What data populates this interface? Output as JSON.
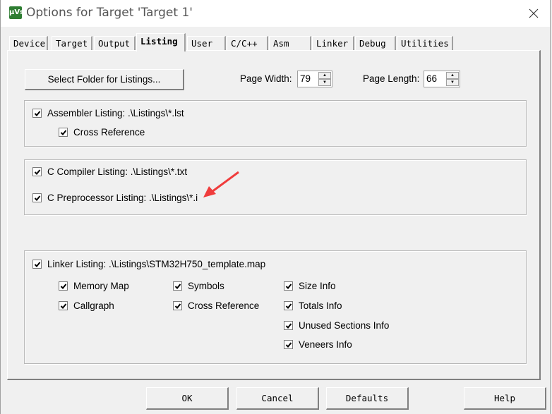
{
  "window": {
    "title": "Options for Target 'Target 1'",
    "app_icon_label": "µVs"
  },
  "tabs": [
    {
      "label": "Device",
      "active": false
    },
    {
      "label": "Target",
      "active": false
    },
    {
      "label": "Output",
      "active": false
    },
    {
      "label": "Listing",
      "active": true
    },
    {
      "label": "User",
      "active": false
    },
    {
      "label": "C/C++",
      "active": false
    },
    {
      "label": "Asm",
      "active": false
    },
    {
      "label": "Linker",
      "active": false
    },
    {
      "label": "Debug",
      "active": false
    },
    {
      "label": "Utilities",
      "active": false
    }
  ],
  "listing": {
    "select_folder_button": "Select Folder for Listings...",
    "page_width_label": "Page Width:",
    "page_width_value": "79",
    "page_length_label": "Page Length:",
    "page_length_value": "66",
    "assembler": {
      "label": "Assembler Listing:  .\\Listings\\*.lst",
      "checked": true,
      "cross_reference": {
        "label": "Cross Reference",
        "checked": true
      }
    },
    "c_compiler": {
      "label": "C Compiler Listing:  .\\Listings\\*.txt",
      "checked": true
    },
    "c_preprocessor": {
      "label": "C Preprocessor Listing:  .\\Listings\\*.i",
      "checked": true
    },
    "linker": {
      "label": "Linker Listing:  .\\Listings\\STM32H750_template.map",
      "checked": true,
      "options": [
        {
          "label": "Memory Map",
          "checked": true
        },
        {
          "label": "Callgraph",
          "checked": true
        },
        {
          "label": "Symbols",
          "checked": true
        },
        {
          "label": "Cross Reference",
          "checked": true
        },
        {
          "label": "Size Info",
          "checked": true
        },
        {
          "label": "Totals Info",
          "checked": true
        },
        {
          "label": "Unused Sections Info",
          "checked": true
        },
        {
          "label": "Veneers Info",
          "checked": true
        }
      ]
    }
  },
  "buttons": {
    "ok": "OK",
    "cancel": "Cancel",
    "defaults": "Defaults",
    "help": "Help"
  },
  "annotation": {
    "color": "#f03c3c"
  }
}
